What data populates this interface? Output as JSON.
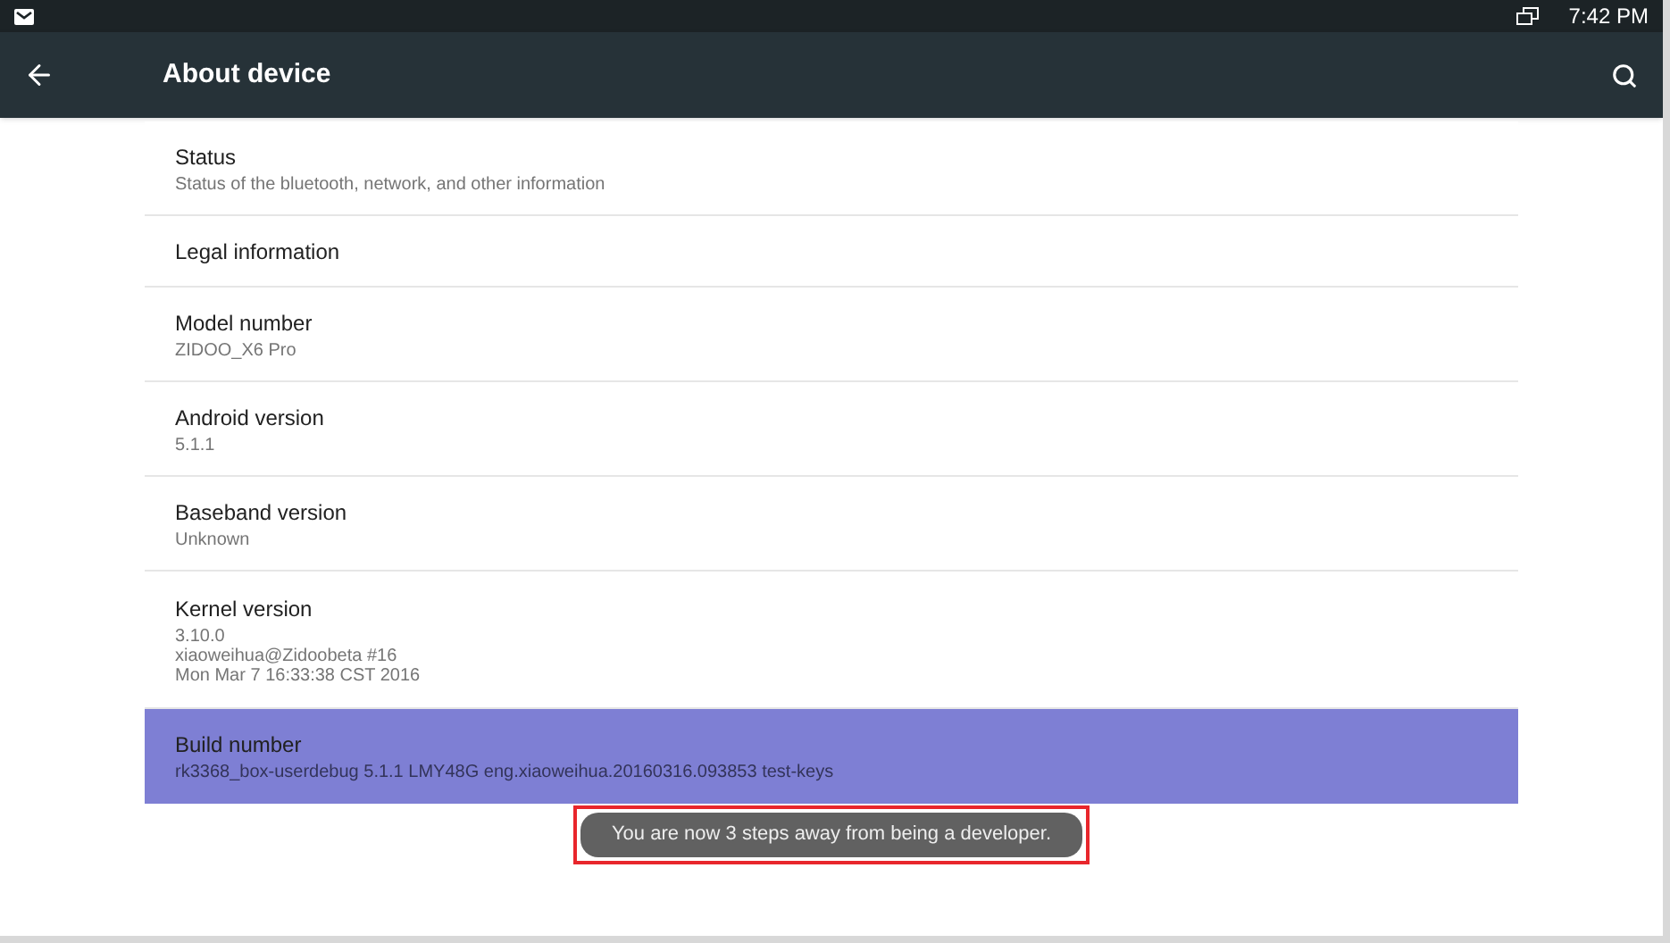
{
  "status_bar": {
    "time": "7:42 PM"
  },
  "app_bar": {
    "title": "About device"
  },
  "items": [
    {
      "title": "Status",
      "summary": "Status of the bluetooth, network, and other information",
      "selected": false
    },
    {
      "title": "Legal information",
      "selected": false
    },
    {
      "title": "Model number",
      "summary": "ZIDOO_X6 Pro",
      "selected": false
    },
    {
      "title": "Android version",
      "summary": "5.1.1",
      "selected": false
    },
    {
      "title": "Baseband version",
      "summary": "Unknown",
      "selected": false
    },
    {
      "title": "Kernel version",
      "summary": "3.10.0\nxiaoweihua@Zidoobeta #16\nMon Mar 7 16:33:38 CST 2016",
      "selected": false
    },
    {
      "title": "Build number",
      "summary": "rk3368_box-userdebug 5.1.1 LMY48G eng.xiaoweihua.20160316.093853 test-keys",
      "selected": true
    }
  ],
  "toast": {
    "text": "You are now 3 steps away from being a developer.",
    "highlighted": true
  }
}
